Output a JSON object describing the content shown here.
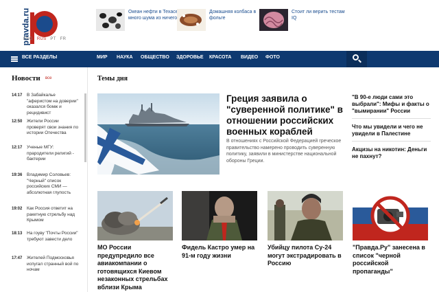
{
  "header": {
    "logo_text": "pravda.ru",
    "languages": [
      "ENG",
      "RUS",
      "PT",
      "FR"
    ],
    "top_news": [
      {
        "title": "Океан нефти в Техасе: много шума из ничего"
      },
      {
        "title": "Домашняя колбаса в фольге"
      },
      {
        "title": "Стоит ли верить тестам IQ"
      }
    ]
  },
  "nav": {
    "sections_label": "ВСЕ РАЗДЕЛЫ",
    "items": [
      "МИР",
      "НАУКА",
      "ОБЩЕСТВО",
      "ЗДОРОВЬЕ",
      "КРАСОТА",
      "ВИДЕО",
      "ФОТО"
    ]
  },
  "news_feed": {
    "title": "Новости",
    "all_link": "все",
    "items": [
      {
        "time": "14:17",
        "title": "В Забайкалье \"аферистом на доверии\" оказался бомж и рецидивист"
      },
      {
        "time": "12:50",
        "title": "Жители России проверят свои знания по истории Отечества"
      },
      {
        "time": "12:17",
        "title": "Ученые МГУ: прародители религий - бактерии"
      },
      {
        "time": "19:36",
        "title": "Владимир Соловьев: \"Черный\" список российских СМИ — абсолютная глупость"
      },
      {
        "time": "19:02",
        "title": "Как Россия ответит на ракетную стрельбу над Крымом"
      },
      {
        "time": "18:13",
        "title": "На гоуву \"Почты России\" требуют завести дело"
      },
      {
        "time": "17:47",
        "title": "Жителей Подмосковья испугал странный вой по ночам"
      }
    ]
  },
  "main": {
    "section_title": "Темы дня",
    "hero": {
      "title": "Греция заявила о \"суверенной политике\" в отношении российских военных кораблей",
      "lead": "В отношениях с Российской Федерацией греческое правительство намерено проводить суверенную политику, заявили в министерстве национальной обороны Греции."
    },
    "side_news": [
      {
        "title": "\"В 90-е люди сами это выбрали\": Мифы и факты о \"вымирании\" России"
      },
      {
        "title": "Что мы увидели и чего не увидели в Палестине"
      },
      {
        "title": "Акцизы на никотин: Деньги не пахнут?"
      }
    ],
    "cards": [
      {
        "title": "МО России предупредило все авиакомпании о готовящихся Киевом незаконных стрельбах вблизи Крыма"
      },
      {
        "title": "Фидель Кастро умер на 91-м году жизни"
      },
      {
        "title": "Убийцу пилота Су-24 могут экстрадировать в Россию"
      },
      {
        "title": "\"Правда.Ру\" занесена в список \"черной российской пропаганды\""
      }
    ]
  },
  "colors": {
    "brand_blue": "#0e3970",
    "brand_red": "#c0261e",
    "link_blue": "#1a4d8f"
  }
}
